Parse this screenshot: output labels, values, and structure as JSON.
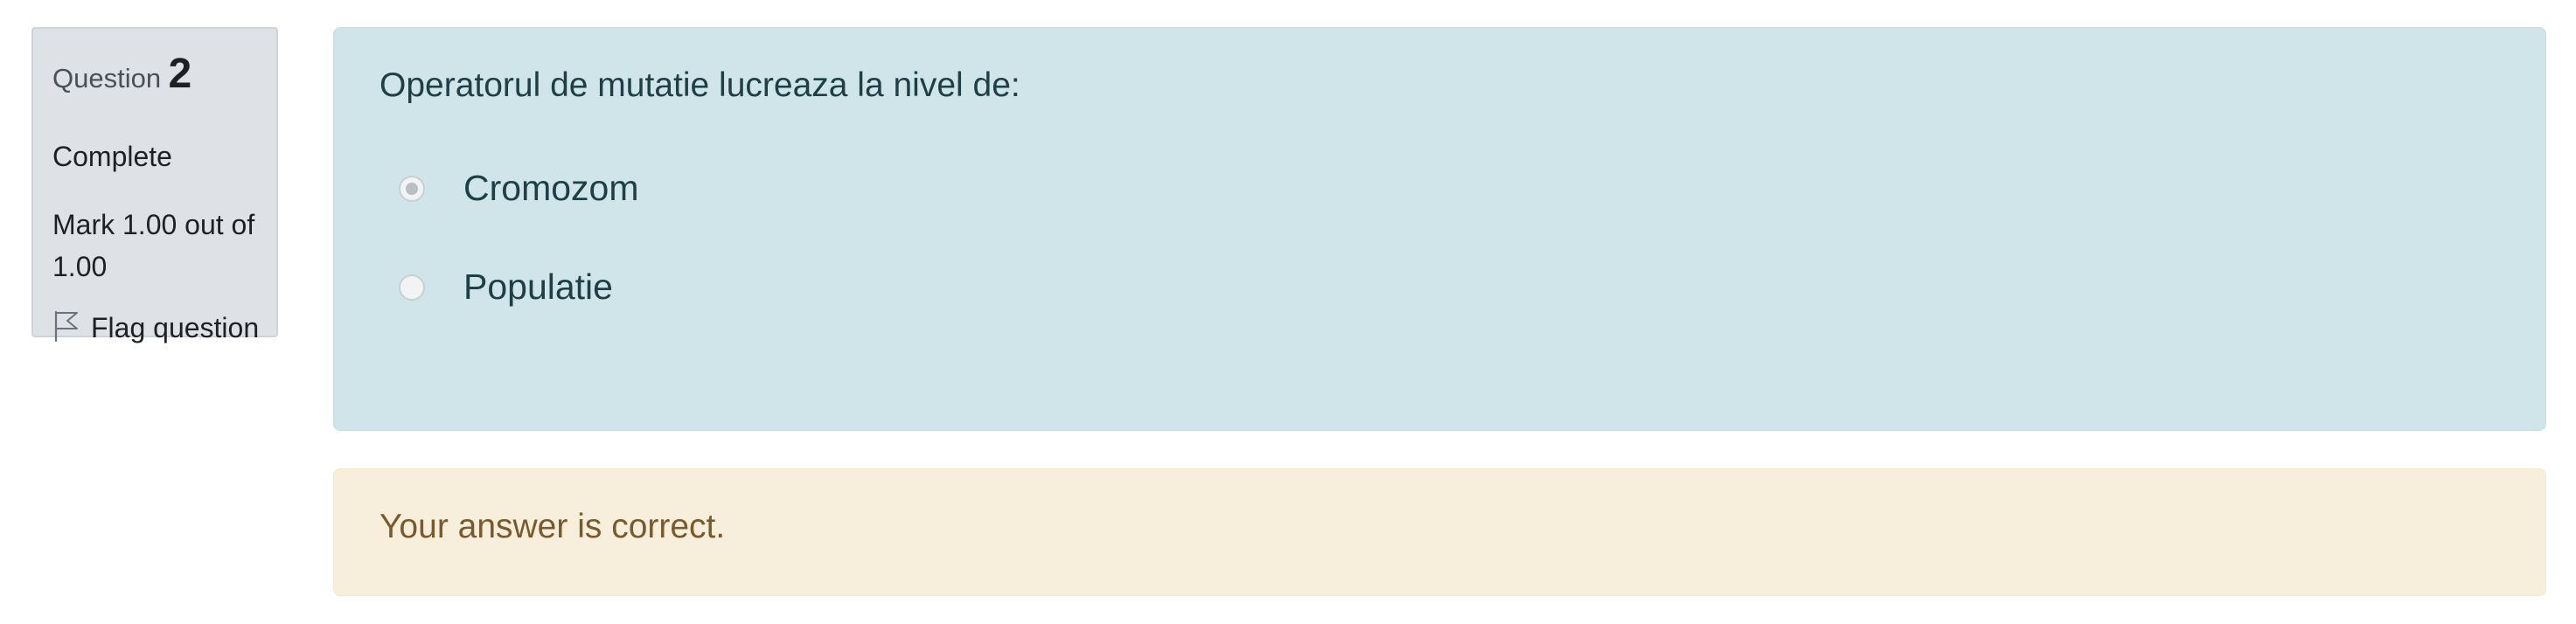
{
  "info": {
    "question_label": "Question",
    "question_number": "2",
    "state": "Complete",
    "grade": "Mark 1.00 out of 1.00",
    "flag_label": "Flag question"
  },
  "question": {
    "text": "Operatorul de mutatie lucreaza la nivel de:",
    "options": [
      {
        "label": "Cromozom",
        "selected": true
      },
      {
        "label": "Populatie",
        "selected": false
      }
    ]
  },
  "feedback": {
    "text": "Your answer is correct."
  },
  "colors": {
    "info_bg": "#dee2e6",
    "question_bg": "#cfe5e9",
    "feedback_bg": "#f8eedc",
    "feedback_text": "#7a5a2b"
  },
  "icons": {
    "flag": "flag-icon"
  }
}
